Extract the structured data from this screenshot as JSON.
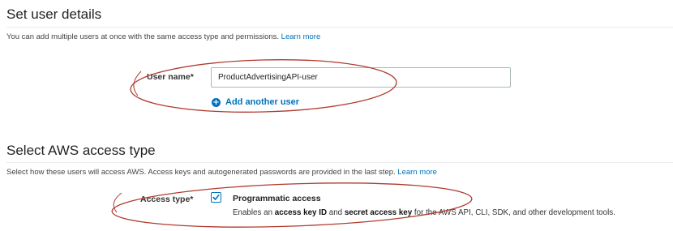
{
  "details_section": {
    "title": "Set user details",
    "description": "You can add multiple users at once with the same access type and permissions.",
    "learn_more": "Learn more",
    "user_name_label": "User name*",
    "user_name_value": "ProductAdvertisingAPI-user",
    "add_another_user": "Add another user"
  },
  "access_section": {
    "title": "Select AWS access type",
    "description": "Select how these users will access AWS. Access keys and autogenerated passwords are provided in the last step.",
    "learn_more": "Learn more",
    "access_type_label": "Access type*",
    "option": {
      "checked": true,
      "title": "Programmatic access",
      "desc_before": "Enables an ",
      "desc_bold1": "access key ID",
      "desc_middle": " and ",
      "desc_bold2": "secret access key",
      "desc_after": " for the AWS API, CLI, SDK, and other development tools."
    }
  },
  "colors": {
    "link": "#0073bb",
    "annotation": "#b03a2e"
  },
  "icons": {
    "add_user": "plus-circle-icon",
    "checkbox": "checkmark-icon"
  }
}
